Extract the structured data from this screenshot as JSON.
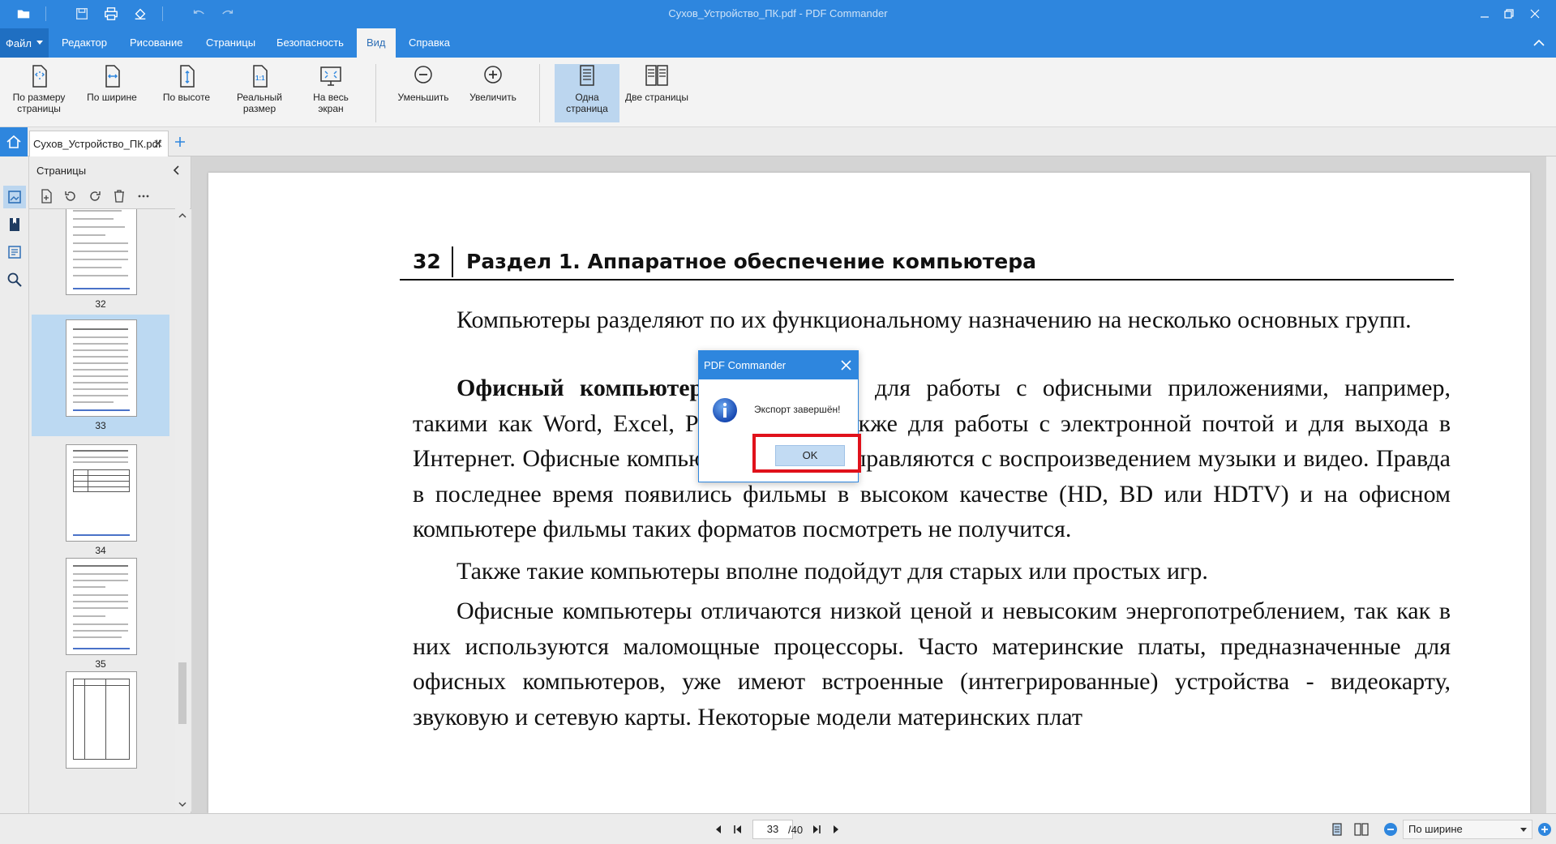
{
  "window": {
    "title": "Сухов_Устройство_ПК.pdf - PDF Commander"
  },
  "menu": {
    "file_label": "Файл",
    "tabs": [
      {
        "label": "Редактор"
      },
      {
        "label": "Рисование"
      },
      {
        "label": "Страницы"
      },
      {
        "label": "Безопасность"
      },
      {
        "label": "Вид"
      },
      {
        "label": "Справка"
      }
    ],
    "active_tab": "Вид"
  },
  "ribbon": {
    "buttons": [
      {
        "label": "По размеру страницы"
      },
      {
        "label": "По ширине"
      },
      {
        "label": "По высоте"
      },
      {
        "label": "Реальный размер"
      },
      {
        "label": "На весь экран"
      },
      {
        "label": "Уменьшить"
      },
      {
        "label": "Увеличить"
      },
      {
        "label": "Одна страница"
      },
      {
        "label": "Две страницы"
      }
    ],
    "active_button": "Одна страница"
  },
  "document_tab": {
    "filename": "Сухов_Устройство_ПК.pdf"
  },
  "pages_panel": {
    "title": "Страницы",
    "thumbnails": [
      {
        "number": "32"
      },
      {
        "number": "33"
      },
      {
        "number": "34"
      },
      {
        "number": "35"
      }
    ],
    "selected_page": "33"
  },
  "page": {
    "header_number": "32",
    "header_title": "Раздел 1. Аппаратное обеспечение компьютера",
    "p1": "Компьютеры разделяют по их функциональному назначению на несколько основных групп.",
    "p2_bold": "Офисный компьютер",
    "p2_rest": " предназначен для работы с офисными приложениями, например, такими как Word, Excel, PowerPoint, а также для работы с электронной почтой и для выхода в Интернет. Офисные компьютеры вполне справляются с воспроизведением музыки и видео. Правда в последнее время появились фильмы в высоком качестве (HD,  BD или HDTV) и на офисном компьютере фильмы таких форматов посмотреть не получится.",
    "p3": "Также такие компьютеры вполне подойдут для старых или простых игр.",
    "p4": "Офисные компьютеры отличаются низкой ценой и невысоким энергопотреблением, так как в них используются маломощные процессоры. Часто материнские платы, предназначенные для офисных компьютеров, уже имеют встроенные (интегрированные) устройства - видеокарту, звуковую и сетевую карты. Некоторые модели материнских плат"
  },
  "statusbar": {
    "current_page": "33",
    "total_pages": "/40",
    "zoom_mode": "По ширине"
  },
  "dialog": {
    "title": "PDF Commander",
    "message": "Экспорт завершён!",
    "ok_label": "OK"
  },
  "colors": {
    "accent": "#2e86de",
    "highlight": "#e0111b",
    "selection": "#bcd9f2"
  }
}
